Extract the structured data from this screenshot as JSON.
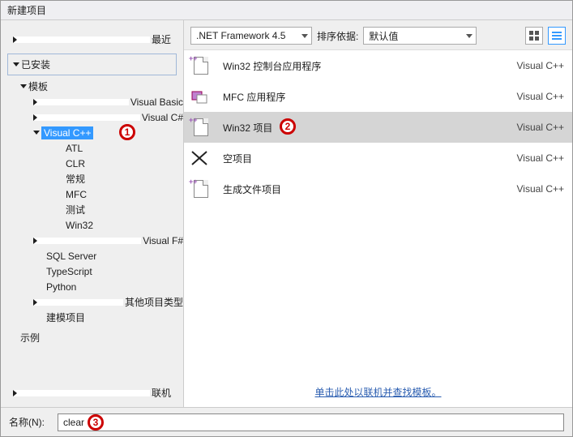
{
  "window": {
    "title": "新建项目"
  },
  "left": {
    "recent": "最近",
    "installed": "已安装",
    "templates": "模板",
    "nodes": {
      "vb": "Visual Basic",
      "cs": "Visual C#",
      "vcpp": "Visual C++",
      "vcpp_children": [
        "ATL",
        "CLR",
        "常规",
        "MFC",
        "测试",
        "Win32"
      ],
      "fs": "Visual F#",
      "sql": "SQL Server",
      "ts": "TypeScript",
      "py": "Python",
      "other": "其他项目类型",
      "modeling": "建模项目"
    },
    "samples": "示例",
    "online": "联机"
  },
  "toolbar": {
    "framework": ".NET Framework 4.5",
    "sort_label": "排序依据:",
    "sort_value": "默认值"
  },
  "list": {
    "lang": "Visual C++",
    "items": [
      {
        "name": "Win32 控制台应用程序"
      },
      {
        "name": "MFC 应用程序"
      },
      {
        "name": "Win32 项目"
      },
      {
        "name": "空项目"
      },
      {
        "name": "生成文件项目"
      }
    ]
  },
  "link": "单击此处以联机并查找模板。",
  "footer": {
    "name_label": "名称(N):",
    "name_value": "clear"
  },
  "annotations": {
    "a1": "1",
    "a2": "2",
    "a3": "3"
  }
}
